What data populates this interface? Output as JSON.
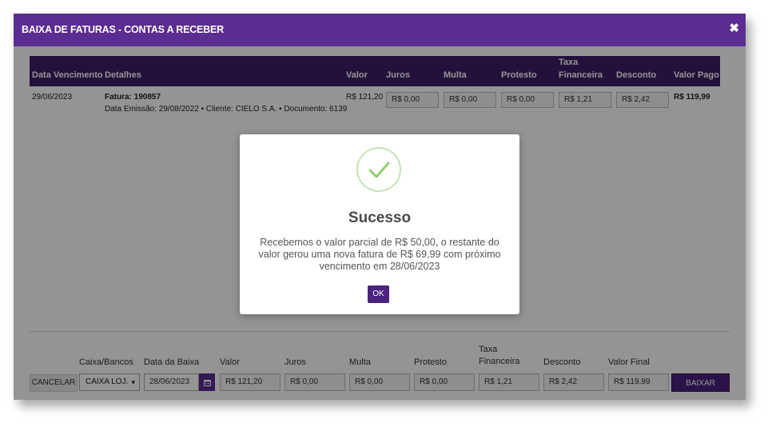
{
  "window": {
    "title": "BAIXA DE FATURAS - CONTAS A RECEBER",
    "close_glyph": "✖"
  },
  "table": {
    "headers": {
      "vencimento": "Data Vencimento",
      "detalhes": "Detalhes",
      "valor": "Valor",
      "juros": "Juros",
      "multa": "Multa",
      "protesto": "Protesto",
      "taxa_line1": "Taxa",
      "taxa_line2": "Financeira",
      "desconto": "Desconto",
      "valor_pago": "Valor Pago"
    },
    "row": {
      "vencimento": "29/06/2023",
      "fatura": "Fatura: 190857",
      "detalhes": "Data Emissão: 29/08/2022 • Cliente: CIELO S.A. • Documento: 6139",
      "valor": "R$ 121,20",
      "juros": "R$ 0,00",
      "multa": "R$ 0,00",
      "protesto": "R$ 0,00",
      "taxa": "R$ 1,21",
      "desconto": "R$ 2,42",
      "valor_pago": "R$ 119,99"
    }
  },
  "footer": {
    "labels": {
      "caixa": "Caixa/Bancos",
      "data_baixa": "Data da Baixa",
      "valor": "Valor",
      "juros": "Juros",
      "multa": "Multa",
      "protesto": "Protesto",
      "taxa_line1": "Taxa",
      "taxa_line2": "Financeira",
      "desconto": "Desconto",
      "valor_final": "Valor Final"
    },
    "cancel_label": "CANCELAR",
    "caixa_selected": "CAIXA LOJ.",
    "data_baixa": "28/06/2023",
    "valor": "R$ 121,20",
    "juros": "R$ 0,00",
    "multa": "R$ 0,00",
    "protesto": "R$ 0,00",
    "taxa": "R$ 1,21",
    "desconto": "R$ 2,42",
    "valor_final": "R$ 119,99",
    "baixar_label": "BAIXAR",
    "calendar_icon": "calendar-icon"
  },
  "modal": {
    "icon": "check-icon",
    "title": "Sucesso",
    "message": "Recebemos o valor parcial de R$ 50,00, o restante do valor gerou uma nova fatura de R$ 69,99 com próximo vencimento em 28/06/2023",
    "ok_label": "OK",
    "check_color": "#8fcf6a"
  }
}
